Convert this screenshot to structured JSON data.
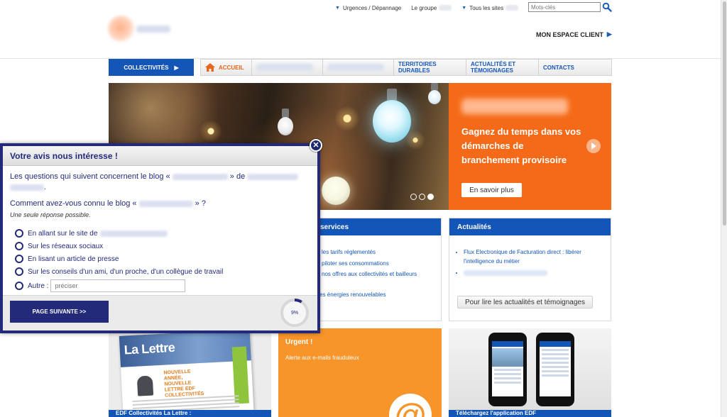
{
  "topbar": {
    "urgences": "Urgences / Dépannage",
    "groupe": "Le groupe",
    "tous_sites": "Tous les sites",
    "search_placeholder": "Mots-clés"
  },
  "header": {
    "espace_client": "MON ESPACE CLIENT"
  },
  "nav": {
    "collectivites": "COLLECTIVITÉS",
    "accueil": "ACCUEIL",
    "territoires": "TERRITOIRES DURABLES",
    "actualites": "ACTUALITÉS ET TÉMOIGNAGES",
    "contacts": "CONTACTS"
  },
  "hero": {
    "headline": "Gagnez du temps dans vos démarches de branchement provisoire",
    "more_button": "En savoir plus"
  },
  "services": {
    "title": "services",
    "items": [
      "les tarifs réglementés",
      "piloter ses consommations",
      "nos offres aux collectivités et bailleurs",
      "er les énergies renouvelables"
    ]
  },
  "actualites": {
    "title": "Actualités",
    "item1": "Flux Electronique de Facturation direct : libérer l'intelligence du métier",
    "read_button": "Pour lire les actualités et témoignages"
  },
  "lettre": {
    "logo": "La Lettre",
    "subtitle": "NOUVELLE ANNÉE, NOUVELLE LETTRE EDF COLLECTIVITÉS",
    "footer": "EDF Collectivités La Lettre :"
  },
  "urgent": {
    "title": "Urgent !",
    "desc": "Alerte aux e-mails frauduleux",
    "icon": "@"
  },
  "app": {
    "footer": "Téléchargez l'application EDF"
  },
  "survey": {
    "title": "Votre avis nous intéresse !",
    "intro_a": "Les questions qui suivent concernent le blog «",
    "intro_b": "» de",
    "intro_c": ".",
    "question_a": "Comment avez-vous connu le blog «",
    "question_b": "» ?",
    "hint": "Une seule réponse possible.",
    "options": [
      "En allant sur le site de",
      "Sur les réseaux sociaux",
      "En lisant un article de presse",
      "Sur les conseils d'un ami, d'un proche, d'un collègue de travail",
      "Autre :"
    ],
    "other_placeholder": "préciser",
    "next_button": "PAGE SUIVANTE >>",
    "progress_percent": 9,
    "progress_label": "9%"
  },
  "colors": {
    "brand_blue": "#1456b8",
    "navy": "#232a7a",
    "orange": "#f56a18",
    "light_orange": "#f7942a"
  }
}
